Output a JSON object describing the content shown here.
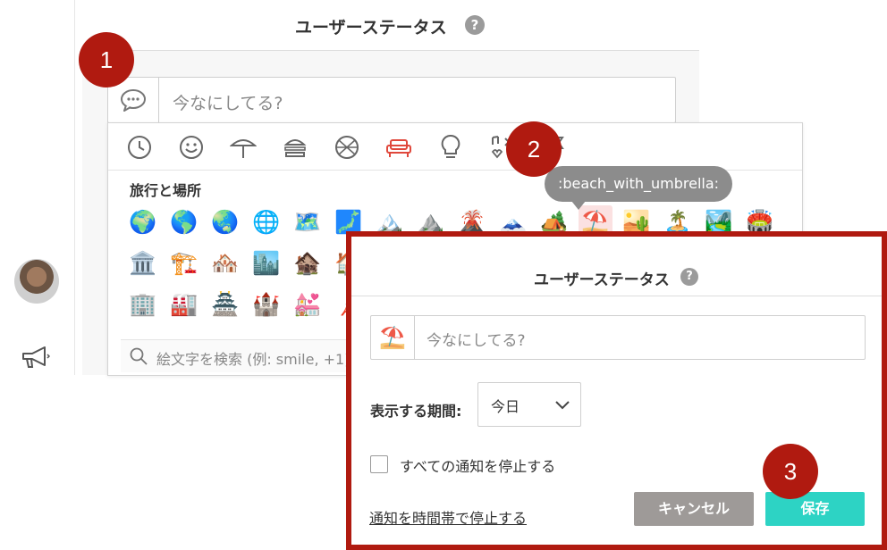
{
  "background_panel": {
    "title": "ユーザーステータス",
    "help": "?",
    "status_placeholder": "今なにしてる?",
    "input_icon": "speech-bubble-icon"
  },
  "emoji_picker": {
    "categories": [
      "clock-icon",
      "smiley-icon",
      "parasol-icon",
      "burger-icon",
      "ball-icon",
      "sofa-icon",
      "lightbulb-icon",
      "symbols-icon",
      "flag-icon"
    ],
    "active_category": "sofa-icon",
    "section_title": "旅行と場所",
    "rows": [
      [
        "🌍",
        "🌎",
        "🌏",
        "🌐",
        "🗺️",
        "🗾",
        "🏔️",
        "⛰️",
        "🌋",
        "🗻",
        "🏕️",
        "⛱️",
        "🏜️",
        "🏝️",
        "🏞️",
        "🏟️"
      ],
      [
        "🏛️",
        "🏗️",
        "🏘️",
        "🏙️",
        "🏚️",
        "🏠"
      ],
      [
        "🏢",
        "🏭",
        "🏯",
        "🏰",
        "💒",
        "🗼"
      ]
    ],
    "selected_emoji": "⛱️",
    "search_placeholder": "絵文字を検索 (例: smile, +1)"
  },
  "tooltip": ":beach_with_umbrella:",
  "steps": [
    "1",
    "2",
    "3"
  ],
  "modal": {
    "title": "ユーザーステータス",
    "help": "?",
    "status_emoji": "⛱️",
    "status_placeholder": "今なにしてる?",
    "period_label": "表示する期間:",
    "period_value": "今日",
    "pause_label": "すべての通知を停止する",
    "schedule_link": "通知を時間帯で停止する",
    "cancel": "キャンセル",
    "save": "保存"
  },
  "colors": {
    "step_red": "#b01a10",
    "save_teal": "#2dd3c4",
    "cancel_gray": "#9e9a98",
    "tooltip_gray": "#8c8c8c"
  }
}
